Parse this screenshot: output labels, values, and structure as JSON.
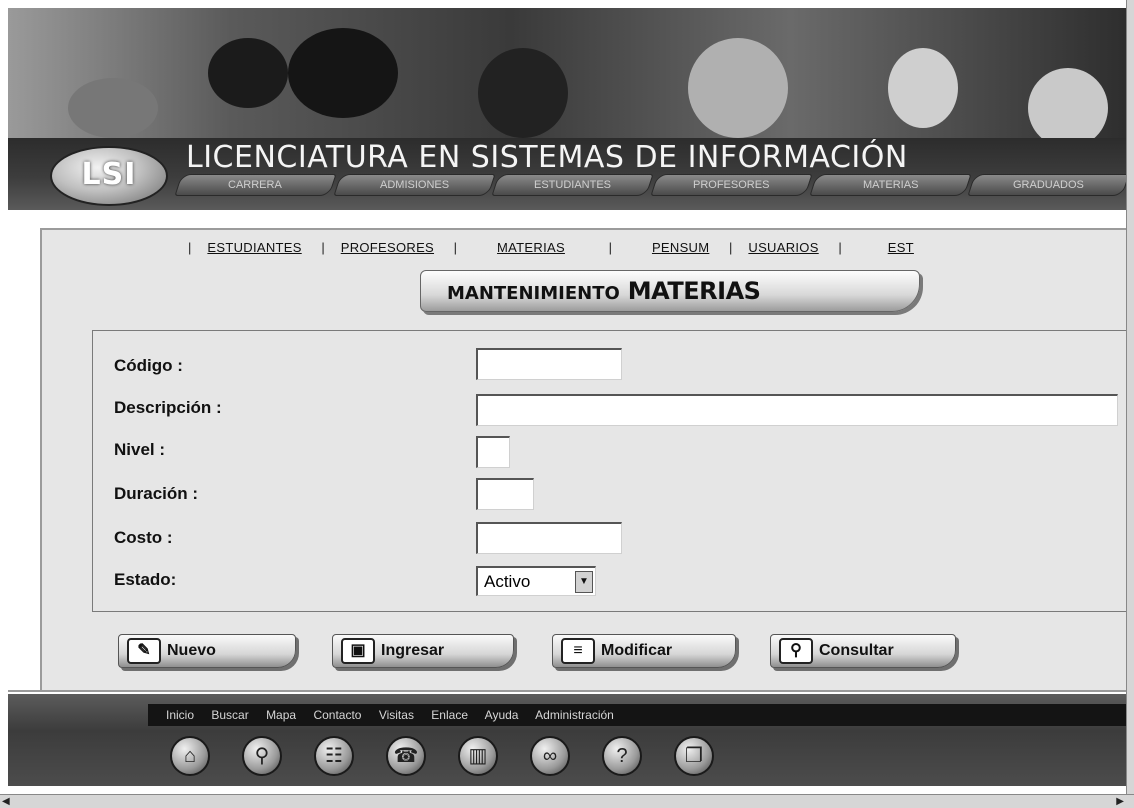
{
  "header": {
    "logo_text": "LSI",
    "site_title": "LICENCIATURA EN SISTEMAS DE INFORMACIÓN",
    "tabs": [
      "CARRERA",
      "ADMISIONES",
      "ESTUDIANTES",
      "PROFESORES",
      "MATERIAS",
      "GRADUADOS"
    ]
  },
  "subnav": {
    "items": [
      "ESTUDIANTES",
      "PROFESORES",
      "MATERIAS",
      "PENSUM",
      "USUARIOS",
      "EST"
    ]
  },
  "section": {
    "title_prefix": "MANTENIMIENTO",
    "title_main": "MATERIAS"
  },
  "form": {
    "codigo_label": "Código :",
    "codigo_value": "",
    "descripcion_label": "Descripción :",
    "descripcion_value": "",
    "nivel_label": "Nivel :",
    "nivel_value": "",
    "duracion_label": "Duración :",
    "duracion_value": "",
    "costo_label": "Costo :",
    "costo_value": "",
    "estado_label": "Estado:",
    "estado_selected": "Activo"
  },
  "actions": {
    "nuevo": "Nuevo",
    "ingresar": "Ingresar",
    "modificar": "Modificar",
    "consultar": "Consultar"
  },
  "footer": {
    "links": [
      "Inicio",
      "Buscar",
      "Mapa",
      "Contacto",
      "Visitas",
      "Enlace",
      "Ayuda",
      "Administración"
    ],
    "icons": [
      "home-icon",
      "search-icon",
      "sitemap-icon",
      "phone-icon",
      "book-icon",
      "links-icon",
      "help-icon",
      "admin-icon"
    ]
  }
}
